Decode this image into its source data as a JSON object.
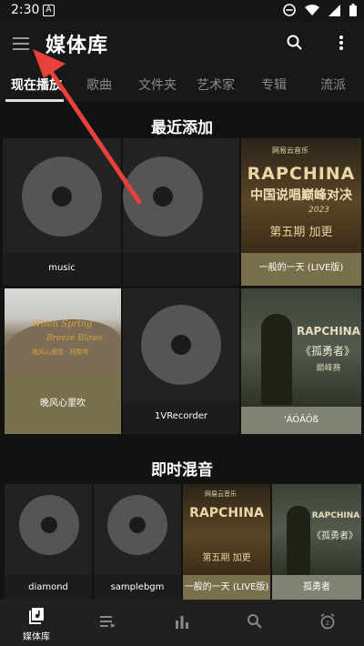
{
  "status_bar": {
    "time": "2:30",
    "app_letter": "A"
  },
  "app_bar": {
    "title": "媒体库"
  },
  "tabs": [
    {
      "label": "现在播放"
    },
    {
      "label": "歌曲"
    },
    {
      "label": "文件夹"
    },
    {
      "label": "艺术家"
    },
    {
      "label": "专辑"
    },
    {
      "label": "流派"
    }
  ],
  "recently_added": {
    "title": "最近添加",
    "items": [
      {
        "caption": "music"
      },
      {
        "caption": ""
      },
      {
        "caption": "一般的一天 (LIVE版)",
        "art_text": [
          "网易云音乐",
          "RAPCHINA",
          "中国说唱巅峰对决",
          "2023",
          "第五期 加更"
        ]
      },
      {
        "caption": "晚风心里吹",
        "art_text": [
          "When Spring",
          "Breeze Blows",
          "晚风心里吹 · 阿梨粤"
        ]
      },
      {
        "caption": "1VRecorder"
      },
      {
        "caption": "'ÁÓÂÔß",
        "art_text": [
          "RAPCHINA",
          "《孤勇者》",
          "巅峰赛"
        ]
      }
    ]
  },
  "instant_mix": {
    "title": "即时混音",
    "items": [
      {
        "caption": "diamond"
      },
      {
        "caption": "samplebgm"
      },
      {
        "caption": "一般的一天 (LIVE版)",
        "art_text": [
          "网易云音乐",
          "RAPCHINA",
          "第五期 加更"
        ]
      },
      {
        "caption": "孤勇者",
        "art_text": [
          "RAPCHINA",
          "《孤勇者》"
        ]
      }
    ]
  },
  "bottom_nav": [
    {
      "label": "媒体库",
      "icon": "library-icon",
      "active": true
    },
    {
      "label": "",
      "icon": "queue-icon"
    },
    {
      "label": "",
      "icon": "stats-icon"
    },
    {
      "label": "",
      "icon": "search-icon"
    },
    {
      "label": "",
      "icon": "timer-icon"
    }
  ],
  "colors": {
    "background": "#121212",
    "caption_olive": "#7a6f4b",
    "caption_gray": "#7e8373",
    "arrow_red": "#e8403a"
  }
}
